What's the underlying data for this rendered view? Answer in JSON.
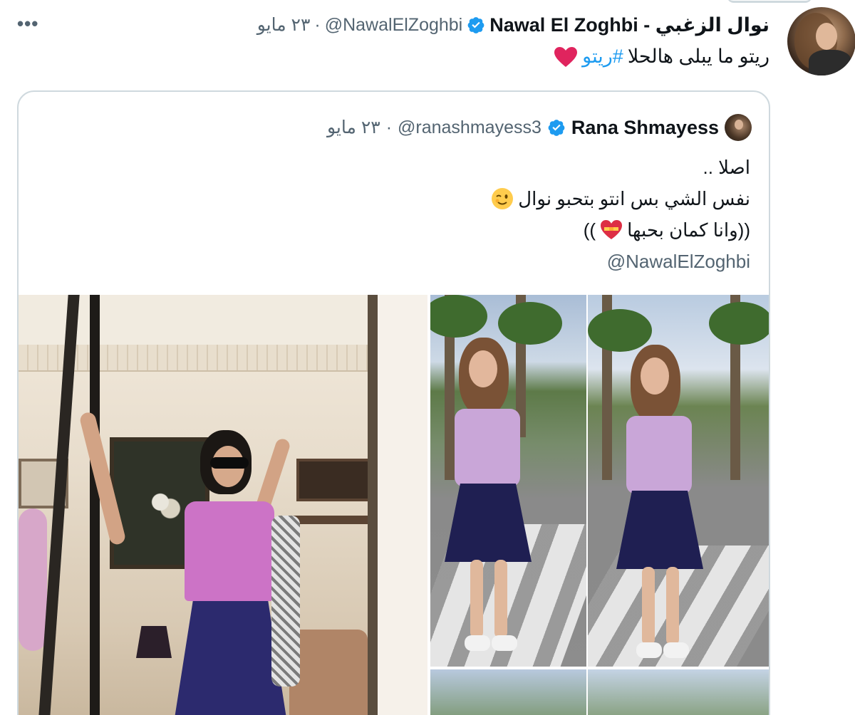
{
  "tweet": {
    "author_name": "Nawal El Zoghbi - نوال الزغبي",
    "handle": "@NawalElZoghbi",
    "separator": "·",
    "time": "٢٣ مايو",
    "more_label": "•••",
    "text": "ريتو ما يبلى هالحلا",
    "hashtag": "#ريتو"
  },
  "quoted": {
    "author_name": "Rana Shmayess",
    "handle": "@ranashmayess3",
    "separator": "·",
    "time": "٢٣ مايو",
    "lines": [
      "اصلا ..",
      "نفس الشي بس انتو بتحبو نوال",
      "((وانا كمان بحبها",
      "@NawalElZoghbi"
    ]
  },
  "colors": {
    "verified": "#1d9bf0",
    "hashtag": "#1d9bf0",
    "heart": "#e0245e",
    "secondary_text": "#536471",
    "border": "#cfd9de"
  },
  "icons": {
    "more": "more-icon",
    "verified": "verified-badge-icon",
    "heart": "red-heart-emoji",
    "wink": "winking-face-emoji",
    "heart_ribbon": "heart-with-ribbon-emoji"
  }
}
